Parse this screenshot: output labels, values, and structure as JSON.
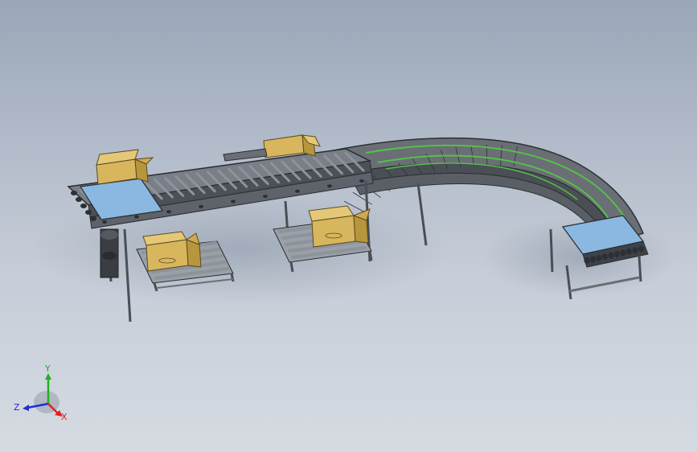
{
  "viewport": {
    "background_top": "#9aa6b8",
    "background_bottom": "#d6dbe2"
  },
  "model": {
    "frame_color": "#3c3f44",
    "roller_color": "#8e939a",
    "rail_color": "#55c04a",
    "panel_color": "#8ab8e0",
    "box_color": "#d8b65e",
    "parts": [
      "straight-roller-conveyor",
      "curved-belt-conveyor",
      "outfeed-roller-table",
      "side-roller-tables",
      "drive-motor",
      "cardboard-boxes"
    ]
  },
  "triad": {
    "x_label": "X",
    "y_label": "Y",
    "z_label": "Z",
    "x_color": "#e02020",
    "y_color": "#20b020",
    "z_color": "#2030d0"
  }
}
